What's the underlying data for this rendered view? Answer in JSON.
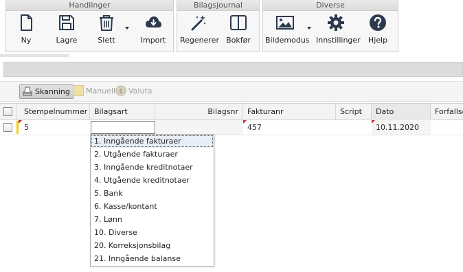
{
  "ribbon": {
    "groups": [
      {
        "title": "Handlinger"
      },
      {
        "title": "Bilagsjournal"
      },
      {
        "title": "Diverse"
      }
    ],
    "buttons": {
      "ny": "Ny",
      "lagre": "Lagre",
      "slett": "Slett",
      "import": "Import",
      "regenerer": "Regenerer",
      "bokfor": "Bokfør",
      "bildemodus": "Bildemodus",
      "innstillinger": "Innstillinger",
      "hjelp": "Hjelp"
    }
  },
  "toolbar": {
    "skanning": "Skanning",
    "manuell": "Manuell",
    "valuta": "Valuta"
  },
  "grid": {
    "headers": {
      "stempelnummer": "Stempelnummer",
      "bilagsart": "Bilagsart",
      "bilagsnr": "Bilagsnr",
      "fakturanr": "Fakturanr",
      "script": "Script",
      "dato": "Dato",
      "forfallsdato": "Forfallsd"
    },
    "row": {
      "stempelnummer": "5",
      "bilagsart": "",
      "bilagsnr": "",
      "fakturanr": "457",
      "script": "",
      "dato": "10.11.2020",
      "forfallsdato": ""
    }
  },
  "bilagsart_options": [
    "1. Inngående fakturaer",
    "2. Utgående fakturaer",
    "3. Inngående kreditnotaer",
    "4. Utgående kreditnotaer",
    "5. Bank",
    "6. Kasse/kontant",
    "7. Lønn",
    "10. Diverse",
    "20. Korreksjonsbilag",
    "21. Inngående balanse"
  ],
  "selected_option_index": 0,
  "colors": {
    "accent_blue": "#2a4f8a",
    "icon_dark": "#2b3a4e",
    "required_marker": "#cc2a2a",
    "row_marker": "#f1d20a"
  }
}
